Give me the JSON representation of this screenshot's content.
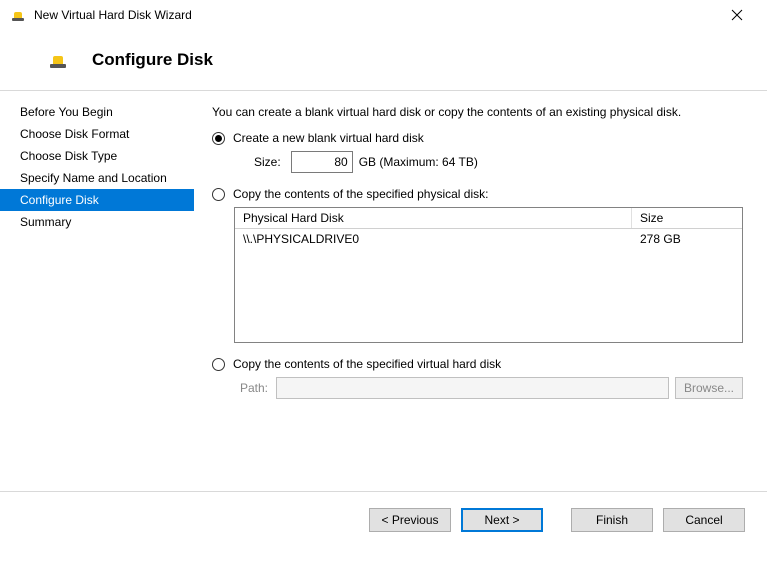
{
  "window": {
    "title": "New Virtual Hard Disk Wizard"
  },
  "header": {
    "title": "Configure Disk"
  },
  "sidebar": {
    "items": [
      {
        "label": "Before You Begin"
      },
      {
        "label": "Choose Disk Format"
      },
      {
        "label": "Choose Disk Type"
      },
      {
        "label": "Specify Name and Location"
      },
      {
        "label": "Configure Disk"
      },
      {
        "label": "Summary"
      }
    ],
    "selected_index": 4
  },
  "content": {
    "intro": "You can create a blank virtual hard disk or copy the contents of an existing physical disk.",
    "option_blank": {
      "label": "Create a new blank virtual hard disk",
      "size_label": "Size:",
      "size_value": "80",
      "size_unit": "GB (Maximum: 64 TB)"
    },
    "option_physical": {
      "label": "Copy the contents of the specified physical disk:",
      "table": {
        "headers": {
          "disk": "Physical Hard Disk",
          "size": "Size"
        },
        "rows": [
          {
            "disk": "\\\\.\\PHYSICALDRIVE0",
            "size": "278 GB"
          }
        ]
      }
    },
    "option_virtual": {
      "label": "Copy the contents of the specified virtual hard disk",
      "path_label": "Path:",
      "path_value": "",
      "browse_label": "Browse..."
    }
  },
  "footer": {
    "previous": "< Previous",
    "next": "Next >",
    "finish": "Finish",
    "cancel": "Cancel"
  }
}
